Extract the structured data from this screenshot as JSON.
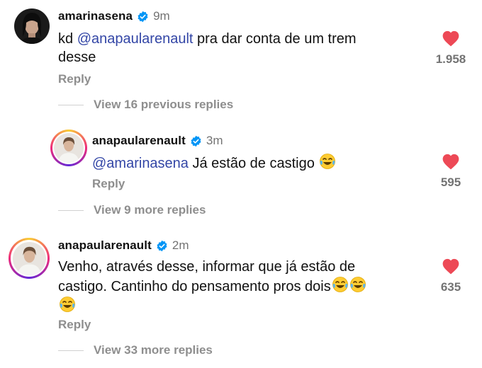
{
  "comments": [
    {
      "username": "amarinasena",
      "time": "9m",
      "mention": "@anapaularenault",
      "text_line1": " pra dar conta de um trem",
      "text_prefix": "kd ",
      "text_line2": "desse",
      "reply_label": "Reply",
      "likes": "1.958"
    },
    {
      "username": "anapaularenault",
      "time": "3m",
      "mention": "@amarinasena",
      "text": " Já estão de castigo",
      "reply_label": "Reply",
      "likes": "595"
    },
    {
      "username": "anapaularenault",
      "time": "2m",
      "text_line1": "Venho, através desse, informar que já estão de",
      "text_line2": "castigo. Cantinho do pensamento pros dois",
      "reply_label": "Reply",
      "likes": "635"
    }
  ],
  "view_replies": [
    "View 16 previous replies",
    "View 9 more replies",
    "View 33 more replies"
  ],
  "icons": {
    "like": "heart-icon",
    "verified": "verified-badge-icon",
    "emoji": "tears-of-joy-emoji"
  },
  "colors": {
    "heart": "#ed4956",
    "verified": "#0095f6",
    "mention": "#3346a6"
  }
}
